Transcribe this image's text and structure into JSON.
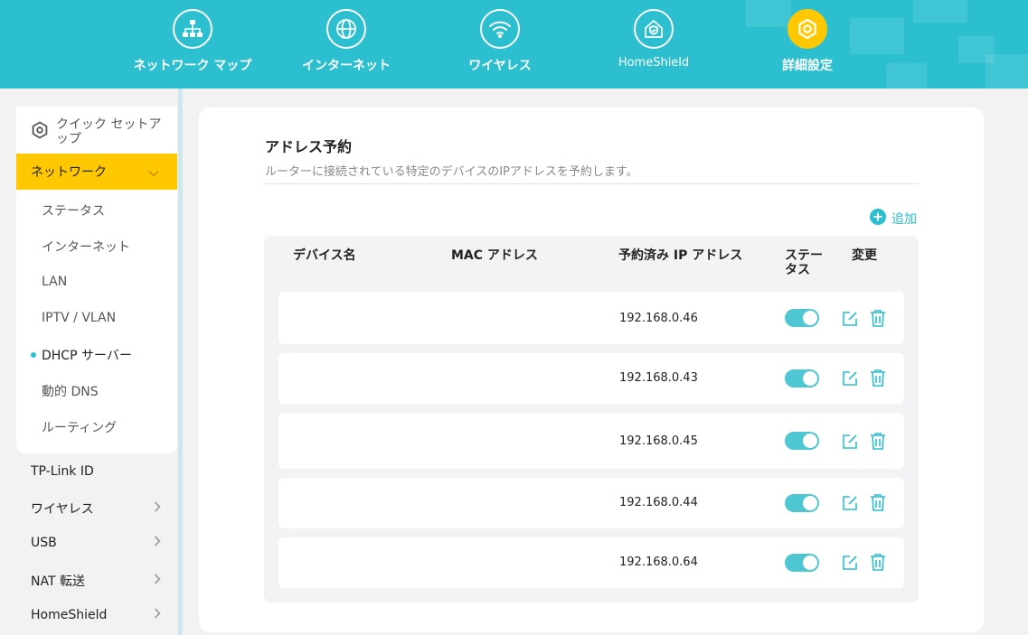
{
  "colors": {
    "accent": "#2bbfd0",
    "active": "#ffc800"
  },
  "topnav": [
    {
      "label": "ネットワーク マップ",
      "icon": "network-map-icon"
    },
    {
      "label": "インターネット",
      "icon": "globe-icon"
    },
    {
      "label": "ワイヤレス",
      "icon": "wifi-icon"
    },
    {
      "label": "HomeShield",
      "icon": "shield-home-icon"
    },
    {
      "label": "詳細設定",
      "icon": "gear-icon",
      "active": true
    }
  ],
  "sidebar": {
    "quick_setup": "クイック セットアップ",
    "network": "ネットワーク",
    "network_sub": [
      "ステータス",
      "インターネット",
      "LAN",
      "IPTV / VLAN",
      "DHCP サーバー",
      "動的 DNS",
      "ルーティング"
    ],
    "active_sub": "DHCP サーバー",
    "items": [
      "TP-Link ID",
      "ワイヤレス",
      "USB",
      "NAT 転送",
      "HomeShield"
    ]
  },
  "main": {
    "title": "アドレス予約",
    "description": "ルーターに接続されている特定のデバイスのIPアドレスを予約します。",
    "add_label": "追加",
    "columns": [
      "デバイス名",
      "MAC アドレス",
      "予約済み IP アドレス",
      "ステータス",
      "変更"
    ],
    "rows": [
      {
        "device": "",
        "mac": "",
        "ip": "192.168.0.46",
        "enabled": true
      },
      {
        "device": "",
        "mac": "",
        "ip": "192.168.0.43",
        "enabled": true
      },
      {
        "device": "",
        "mac": "",
        "ip": "192.168.0.45",
        "enabled": true
      },
      {
        "device": "",
        "mac": "",
        "ip": "192.168.0.44",
        "enabled": true
      },
      {
        "device": "",
        "mac": "",
        "ip": "192.168.0.64",
        "enabled": true
      }
    ]
  }
}
